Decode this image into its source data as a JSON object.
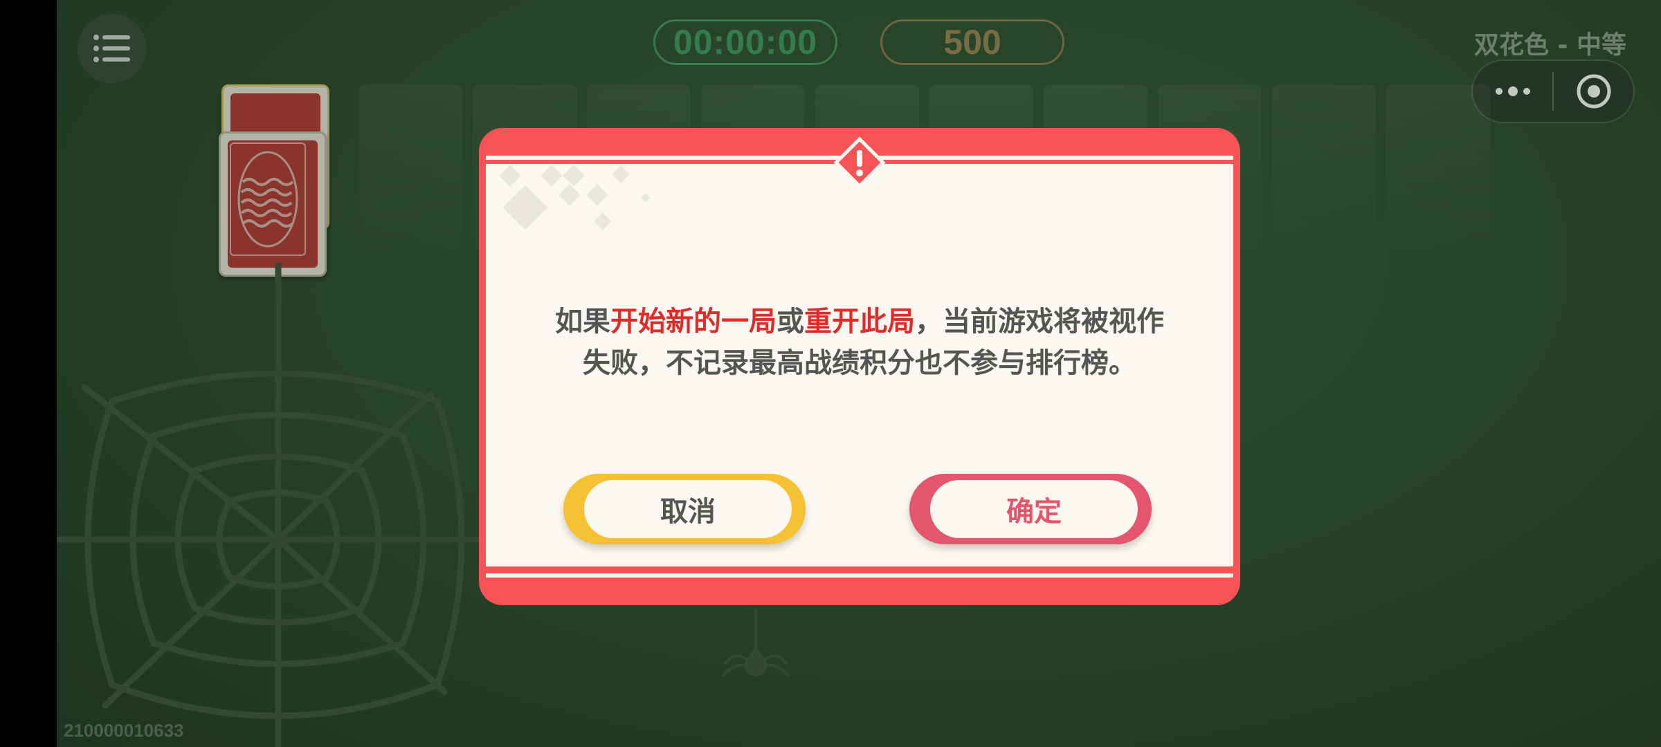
{
  "header": {
    "timer": "00:00:00",
    "score": "500",
    "mode_title": "双花色 - 中等"
  },
  "dialog": {
    "message_part1": "如果",
    "message_highlight1": "开始新的一局",
    "message_part2": "或",
    "message_highlight2": "重开此局",
    "message_part3": "，当前游戏将被视作",
    "message_line2": "失败，不记录最高战绩积分也不参与排行榜。",
    "cancel_label": "取消",
    "confirm_label": "确定"
  },
  "footer": {
    "build_id": "210000010633"
  },
  "colors": {
    "felt": "#2b4a2c",
    "dialog_red": "#f55355",
    "cancel_yellow": "#f5c133",
    "confirm_pink": "#e4566c",
    "timer_green": "#3f9a63",
    "score_tan": "#9a8455"
  },
  "icons": [
    "menu-icon",
    "more-dots-icon",
    "record-icon",
    "alert-icon",
    "spider-web-icon",
    "spider-icon",
    "card-back-icon"
  ]
}
